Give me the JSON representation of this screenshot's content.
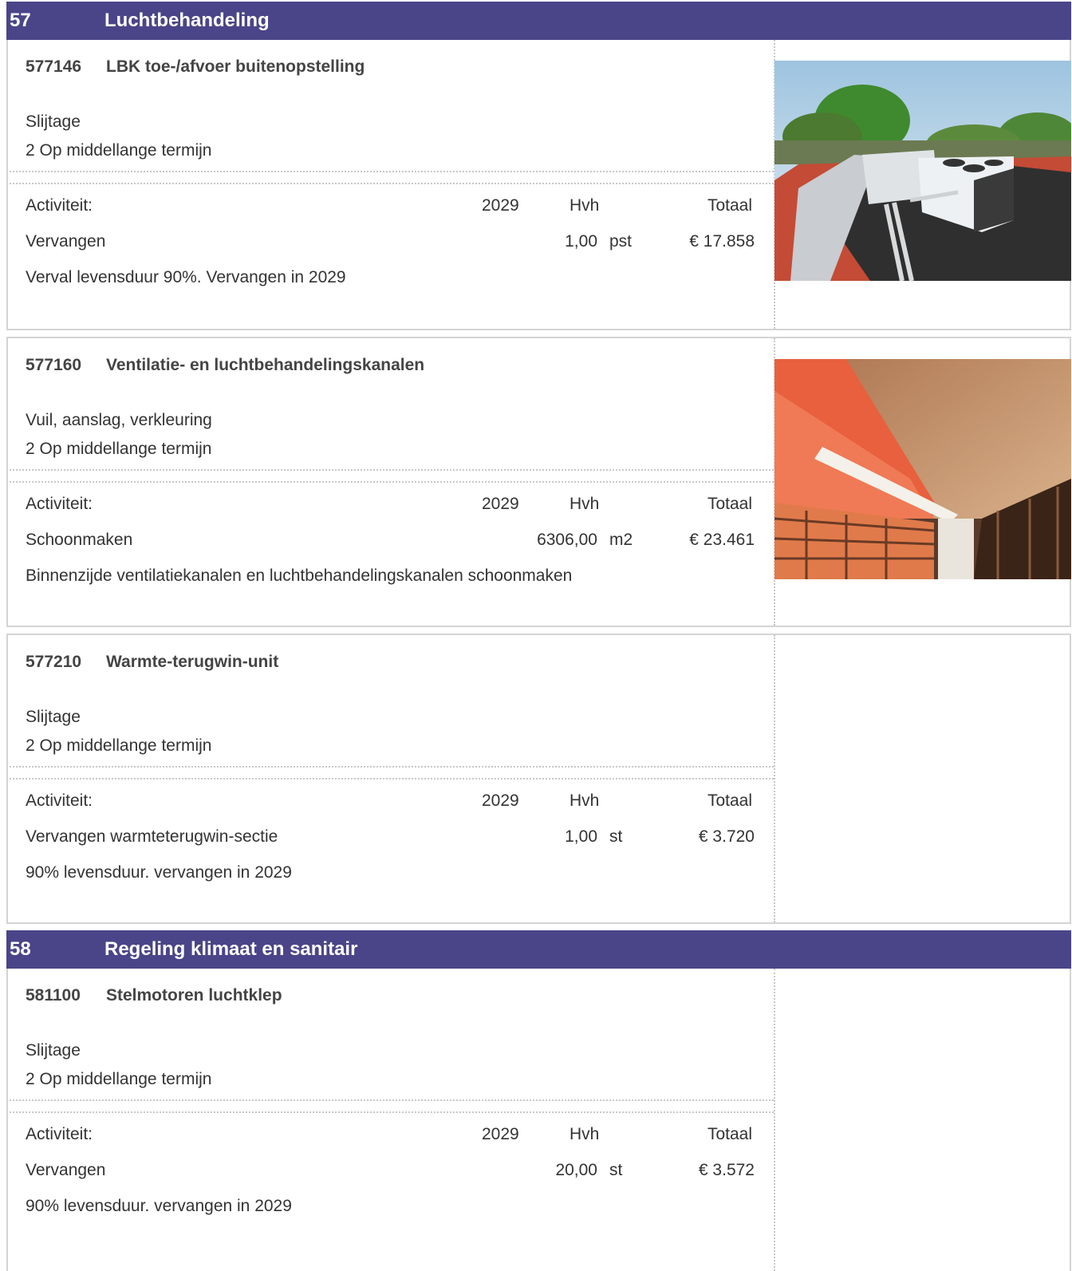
{
  "sections": [
    {
      "number": "57",
      "title": "Luchtbehandeling",
      "items": [
        {
          "code": "577146",
          "title": "LBK toe-/afvoer buitenopstelling",
          "cause": "Slijtage",
          "urgency": "2 Op middellange termijn",
          "header": {
            "activity": "Activiteit:",
            "year": "2029",
            "qty": "Hvh",
            "total": "Totaal"
          },
          "activity": {
            "name": "Vervangen",
            "quantity": "1,00",
            "unit": "pst",
            "total": "€ 17.858"
          },
          "note": "Verval levensduur 90%. Vervangen in 2029",
          "photo": "rooftop-air-handling-unit"
        },
        {
          "code": "577160",
          "title": "Ventilatie- en luchtbehandelingskanalen",
          "cause": "Vuil, aanslag, verkleuring",
          "urgency": "2 Op middellange termijn",
          "header": {
            "activity": "Activiteit:",
            "year": "2029",
            "qty": "Hvh",
            "total": "Totaal"
          },
          "activity": {
            "name": "Schoonmaken",
            "quantity": "6306,00",
            "unit": "m2",
            "total": "€ 23.461"
          },
          "note": "Binnenzijde ventilatiekanalen en luchtbehandelingskanalen schoonmaken",
          "photo": "archive-ventilation-ducts"
        },
        {
          "code": "577210",
          "title": "Warmte-terugwin-unit",
          "cause": "Slijtage",
          "urgency": "2 Op middellange termijn",
          "header": {
            "activity": "Activiteit:",
            "year": "2029",
            "qty": "Hvh",
            "total": "Totaal"
          },
          "activity": {
            "name": "Vervangen warmteterugwin-sectie",
            "quantity": "1,00",
            "unit": "st",
            "total": "€ 3.720"
          },
          "note": "90% levensduur. vervangen in 2029"
        }
      ]
    },
    {
      "number": "58",
      "title": "Regeling klimaat en sanitair",
      "items": [
        {
          "code": "581100",
          "title": "Stelmotoren luchtklep",
          "cause": "Slijtage",
          "urgency": "2 Op middellange termijn",
          "header": {
            "activity": "Activiteit:",
            "year": "2029",
            "qty": "Hvh",
            "total": "Totaal"
          },
          "activity": {
            "name": "Vervangen",
            "quantity": "20,00",
            "unit": "st",
            "total": "€ 3.572"
          },
          "note": "90% levensduur. vervangen in 2029"
        }
      ]
    }
  ],
  "colors": {
    "header_bg": "#4a4588",
    "header_text": "#ffffff",
    "border": "#d4d4d4"
  }
}
